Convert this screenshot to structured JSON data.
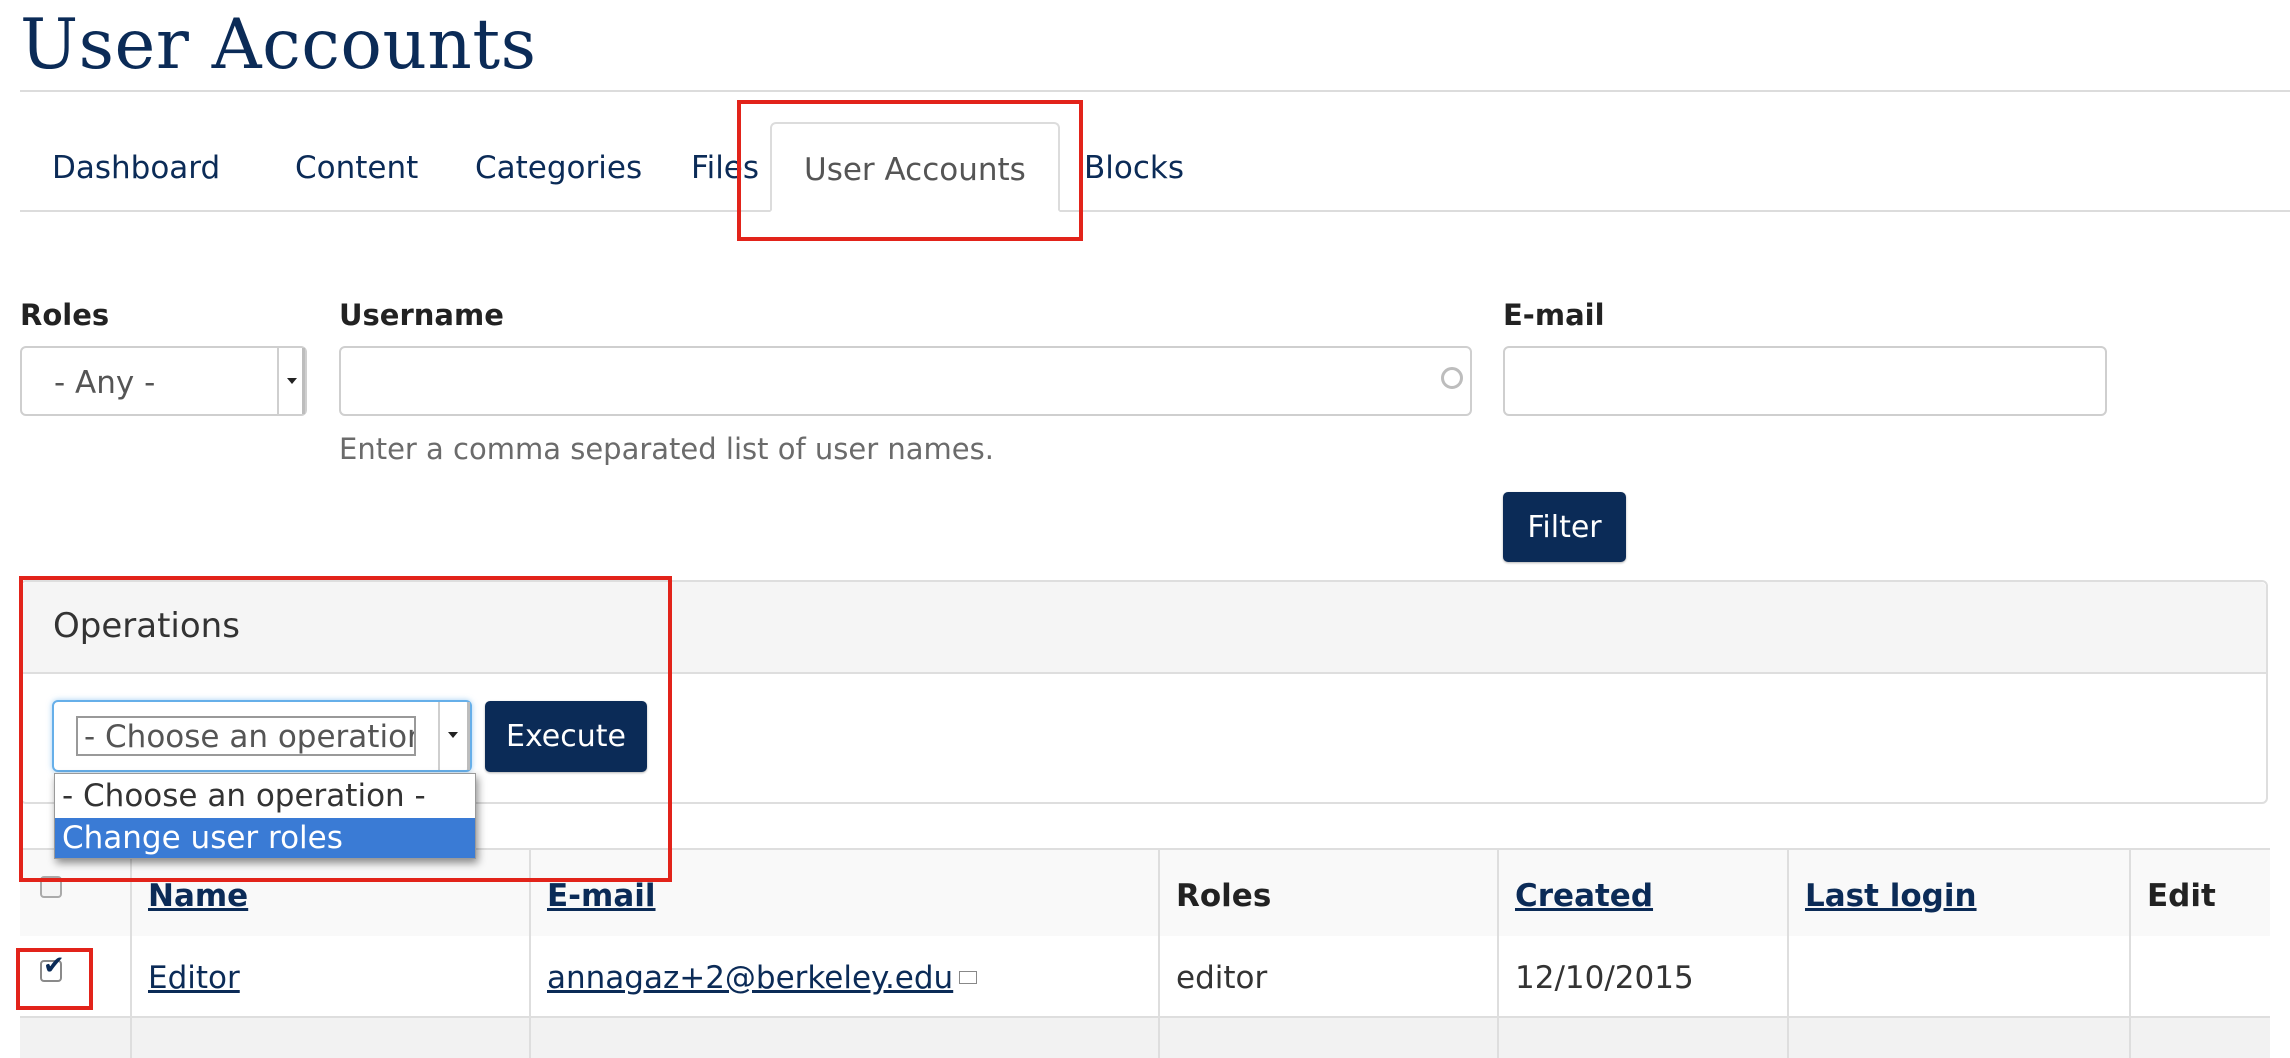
{
  "page": {
    "title": "User Accounts"
  },
  "tabs": [
    {
      "label": "Dashboard",
      "active": false
    },
    {
      "label": "Content",
      "active": false
    },
    {
      "label": "Categories",
      "active": false
    },
    {
      "label": "Files",
      "active": false
    },
    {
      "label": "User Accounts",
      "active": true
    },
    {
      "label": "Blocks",
      "active": false
    }
  ],
  "filters": {
    "roles": {
      "label": "Roles",
      "value": "- Any -"
    },
    "username": {
      "label": "Username",
      "value": "",
      "help": "Enter a comma separated list of user names."
    },
    "email": {
      "label": "E-mail",
      "value": ""
    },
    "filter_button": "Filter"
  },
  "operations": {
    "title": "Operations",
    "select_value": "- Choose an operation -",
    "options": [
      {
        "label": "- Choose an operation -",
        "selected": false
      },
      {
        "label": "Change user roles",
        "selected": true
      }
    ],
    "execute_button": "Execute"
  },
  "table": {
    "headers": [
      "Name",
      "E-mail",
      "Roles",
      "Created",
      "Last login",
      "Edit"
    ],
    "rows": [
      {
        "checked": true,
        "name": "Editor",
        "email": "annagaz+2@berkeley.edu",
        "roles": "editor",
        "created": "12/10/2015",
        "last_login": "",
        "edit": ""
      }
    ]
  },
  "icons": {
    "mail": "mail-icon",
    "search_throbber": "circle-icon",
    "dropdown_caret": "caret-down-icon"
  },
  "colors": {
    "brand": "#0b2b57",
    "highlight": "#e2231a",
    "selected_option": "#3a7bd5"
  }
}
